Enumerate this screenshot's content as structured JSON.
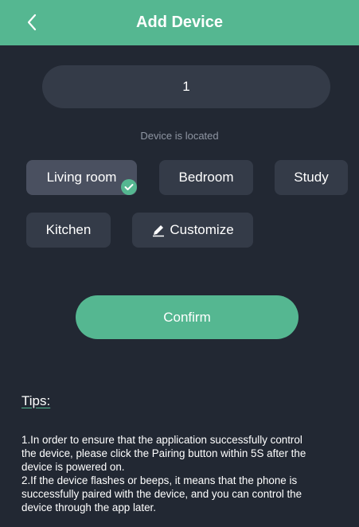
{
  "header": {
    "title": "Add Device",
    "back_icon": "chevron-left-icon",
    "color": "#55b791"
  },
  "device_name": {
    "value": "1"
  },
  "location": {
    "label": "Device is located",
    "rooms": [
      {
        "label": "Living room",
        "selected": true
      },
      {
        "label": "Bedroom",
        "selected": false
      },
      {
        "label": "Study",
        "selected": false
      },
      {
        "label": "Kitchen",
        "selected": false
      }
    ],
    "customize_label": "Customize",
    "customize_icon": "pencil-icon",
    "selected_icon": "check-icon"
  },
  "confirm_label": "Confirm",
  "tips": {
    "title": "Tips:",
    "text": "1.In order to ensure that the application successfully control\nthe device, please click the Pairing button within 5S after the\ndevice is powered on.\n2.If the device flashes or beeps, it means that the phone is\nsuccessfully paired with the device, and you can control the\ndevice through the app later."
  }
}
